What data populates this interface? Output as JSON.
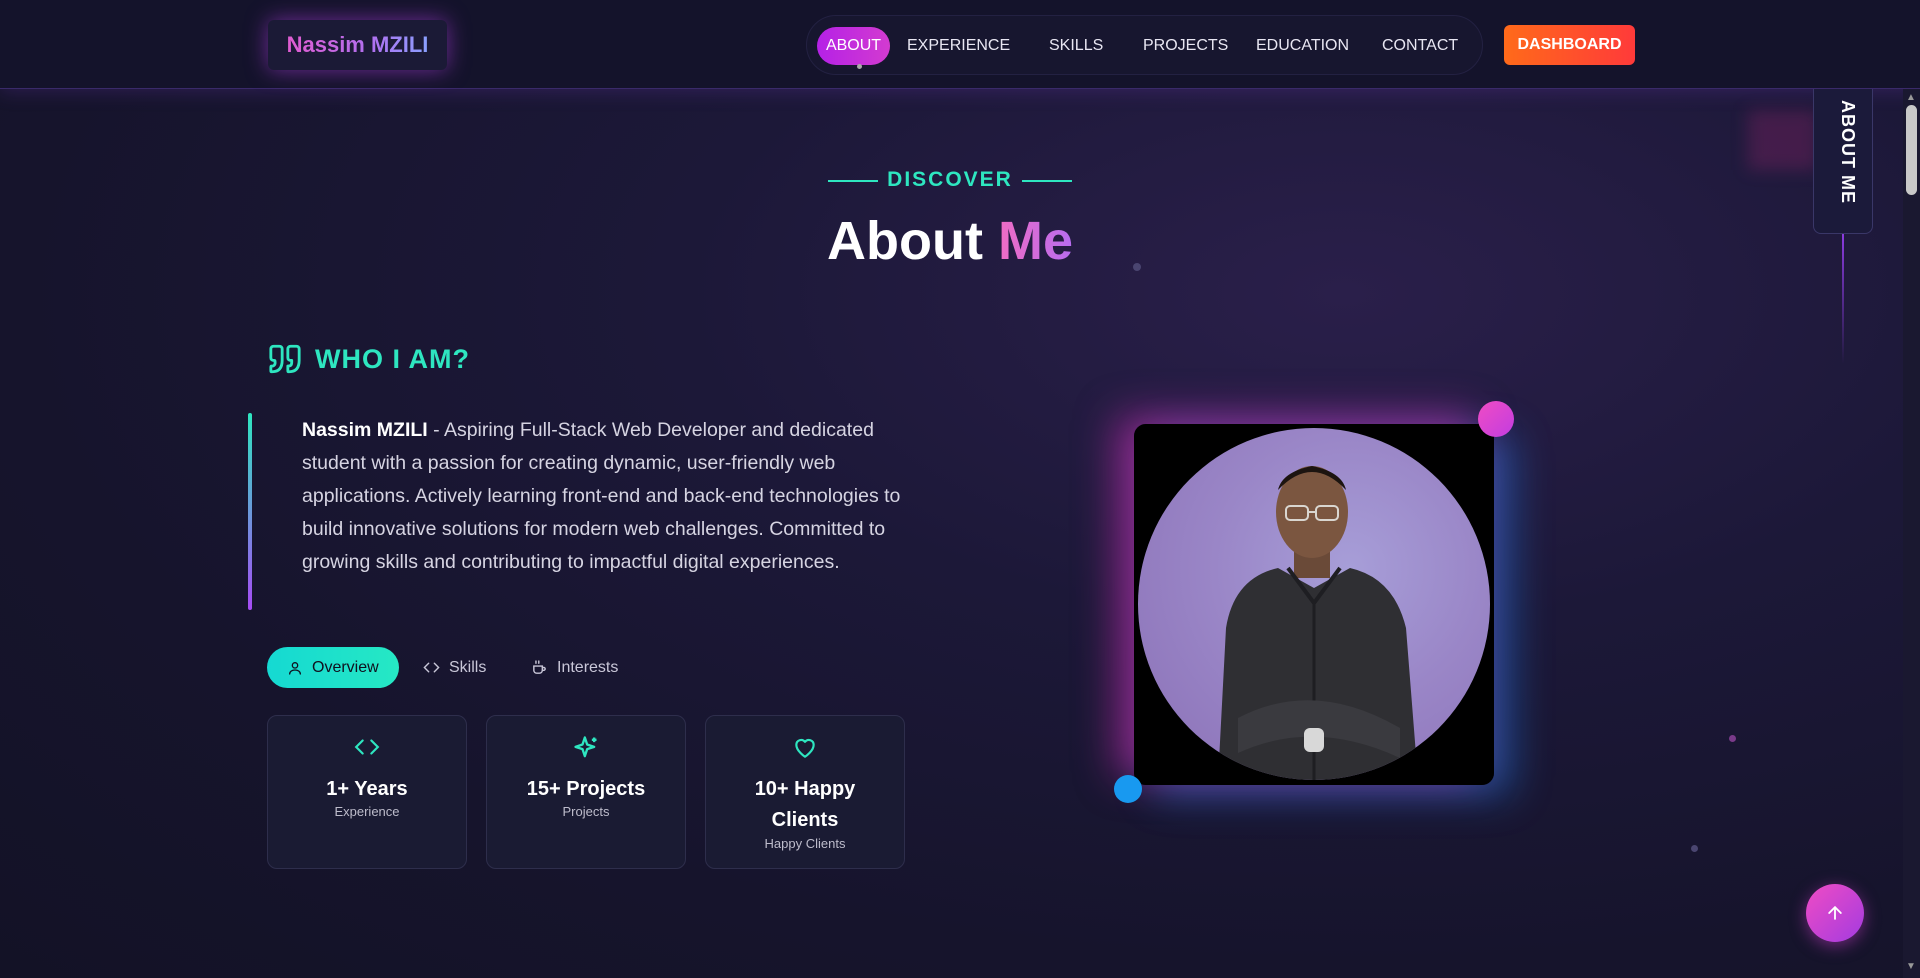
{
  "header": {
    "logo": "Nassim MZILI",
    "nav": [
      {
        "label": "ABOUT",
        "active": true
      },
      {
        "label": "EXPERIENCE"
      },
      {
        "label": "SKILLS"
      },
      {
        "label": "PROJECTS"
      },
      {
        "label": "EDUCATION"
      },
      {
        "label": "CONTACT"
      }
    ],
    "dashboard_label": "DASHBOARD"
  },
  "side_tab": {
    "label": "ABOUT ME"
  },
  "section": {
    "eyebrow": "DISCOVER",
    "title_main": "About",
    "title_accent": "Me"
  },
  "who": {
    "title": "WHO I AM?",
    "name": "Nassim MZILI",
    "bio": " - Aspiring Full-Stack Web Developer and dedicated student with a passion for creating dynamic, user-friendly web applications. Actively learning front-end and back-end technologies to build innovative solutions for modern web challenges. Committed to growing skills and contributing to impactful digital experiences."
  },
  "tabs": [
    {
      "label": "Overview",
      "icon": "user-icon",
      "active": true
    },
    {
      "label": "Skills",
      "icon": "code-icon"
    },
    {
      "label": "Interests",
      "icon": "coffee-icon"
    }
  ],
  "stats": [
    {
      "value": "1+ Years",
      "label": "Experience",
      "icon": "code-icon"
    },
    {
      "value": "15+ Projects",
      "label": "Projects",
      "icon": "sparkles-icon"
    },
    {
      "value": "10+ Happy Clients",
      "label": "Happy Clients",
      "icon": "heart-icon"
    }
  ],
  "profile_photo": {
    "icon": "profile-photo"
  },
  "back_to_top": {
    "icon": "arrow-up-icon"
  },
  "colors": {
    "accent_teal": "#2ee6c0",
    "accent_pink": "#f06cc4",
    "accent_purple": "#b521e6",
    "dashboard_orange": "#ff6a1a",
    "background": "#16142c"
  }
}
